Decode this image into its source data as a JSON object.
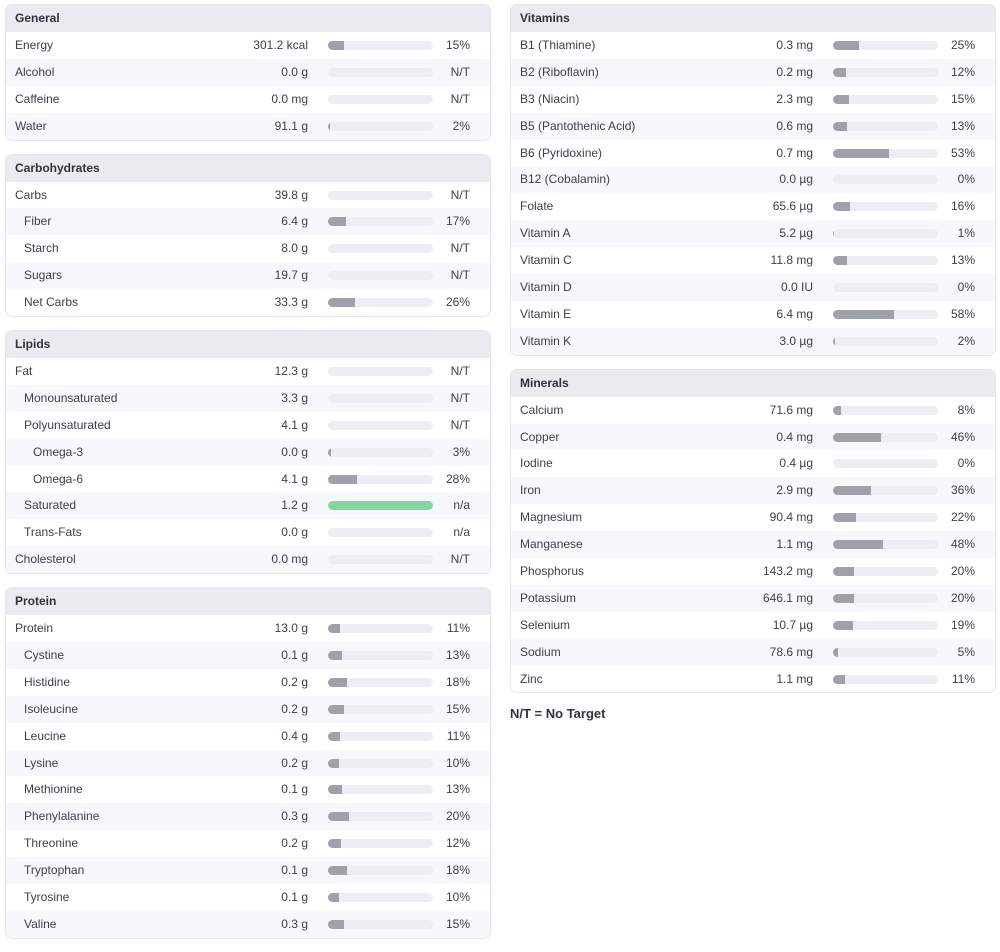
{
  "legend": "N/T = No Target",
  "left_panels": [
    {
      "title": "General",
      "rows": [
        {
          "name": "Energy",
          "amount": "301.2 kcal",
          "pct": "15%",
          "fill": 15,
          "indent": 0
        },
        {
          "name": "Alcohol",
          "amount": "0.0 g",
          "pct": "N/T",
          "fill": 0,
          "indent": 0
        },
        {
          "name": "Caffeine",
          "amount": "0.0 mg",
          "pct": "N/T",
          "fill": 0,
          "indent": 0
        },
        {
          "name": "Water",
          "amount": "91.1 g",
          "pct": "2%",
          "fill": 2,
          "indent": 0
        }
      ]
    },
    {
      "title": "Carbohydrates",
      "rows": [
        {
          "name": "Carbs",
          "amount": "39.8 g",
          "pct": "N/T",
          "fill": 0,
          "indent": 0
        },
        {
          "name": "Fiber",
          "amount": "6.4 g",
          "pct": "17%",
          "fill": 17,
          "indent": 1
        },
        {
          "name": "Starch",
          "amount": "8.0 g",
          "pct": "N/T",
          "fill": 0,
          "indent": 1
        },
        {
          "name": "Sugars",
          "amount": "19.7 g",
          "pct": "N/T",
          "fill": 0,
          "indent": 1
        },
        {
          "name": "Net Carbs",
          "amount": "33.3 g",
          "pct": "26%",
          "fill": 26,
          "indent": 1
        }
      ]
    },
    {
      "title": "Lipids",
      "rows": [
        {
          "name": "Fat",
          "amount": "12.3 g",
          "pct": "N/T",
          "fill": 0,
          "indent": 0
        },
        {
          "name": "Monounsaturated",
          "amount": "3.3 g",
          "pct": "N/T",
          "fill": 0,
          "indent": 1
        },
        {
          "name": "Polyunsaturated",
          "amount": "4.1 g",
          "pct": "N/T",
          "fill": 0,
          "indent": 1
        },
        {
          "name": "Omega-3",
          "amount": "0.0 g",
          "pct": "3%",
          "fill": 3,
          "indent": 2
        },
        {
          "name": "Omega-6",
          "amount": "4.1 g",
          "pct": "28%",
          "fill": 28,
          "indent": 2
        },
        {
          "name": "Saturated",
          "amount": "1.2 g",
          "pct": "n/a",
          "fill": 100,
          "indent": 1,
          "color": "#84d5a0"
        },
        {
          "name": "Trans-Fats",
          "amount": "0.0 g",
          "pct": "n/a",
          "fill": 0,
          "indent": 1
        },
        {
          "name": "Cholesterol",
          "amount": "0.0 mg",
          "pct": "N/T",
          "fill": 0,
          "indent": 0
        }
      ]
    },
    {
      "title": "Protein",
      "rows": [
        {
          "name": "Protein",
          "amount": "13.0 g",
          "pct": "11%",
          "fill": 11,
          "indent": 0
        },
        {
          "name": "Cystine",
          "amount": "0.1 g",
          "pct": "13%",
          "fill": 13,
          "indent": 1
        },
        {
          "name": "Histidine",
          "amount": "0.2 g",
          "pct": "18%",
          "fill": 18,
          "indent": 1
        },
        {
          "name": "Isoleucine",
          "amount": "0.2 g",
          "pct": "15%",
          "fill": 15,
          "indent": 1
        },
        {
          "name": "Leucine",
          "amount": "0.4 g",
          "pct": "11%",
          "fill": 11,
          "indent": 1
        },
        {
          "name": "Lysine",
          "amount": "0.2 g",
          "pct": "10%",
          "fill": 10,
          "indent": 1
        },
        {
          "name": "Methionine",
          "amount": "0.1 g",
          "pct": "13%",
          "fill": 13,
          "indent": 1
        },
        {
          "name": "Phenylalanine",
          "amount": "0.3 g",
          "pct": "20%",
          "fill": 20,
          "indent": 1
        },
        {
          "name": "Threonine",
          "amount": "0.2 g",
          "pct": "12%",
          "fill": 12,
          "indent": 1
        },
        {
          "name": "Tryptophan",
          "amount": "0.1 g",
          "pct": "18%",
          "fill": 18,
          "indent": 1
        },
        {
          "name": "Tyrosine",
          "amount": "0.1 g",
          "pct": "10%",
          "fill": 10,
          "indent": 1
        },
        {
          "name": "Valine",
          "amount": "0.3 g",
          "pct": "15%",
          "fill": 15,
          "indent": 1
        }
      ]
    }
  ],
  "right_panels": [
    {
      "title": "Vitamins",
      "rows": [
        {
          "name": "B1 (Thiamine)",
          "amount": "0.3 mg",
          "pct": "25%",
          "fill": 25,
          "indent": 0
        },
        {
          "name": "B2 (Riboflavin)",
          "amount": "0.2 mg",
          "pct": "12%",
          "fill": 12,
          "indent": 0
        },
        {
          "name": "B3 (Niacin)",
          "amount": "2.3 mg",
          "pct": "15%",
          "fill": 15,
          "indent": 0
        },
        {
          "name": "B5 (Pantothenic Acid)",
          "amount": "0.6 mg",
          "pct": "13%",
          "fill": 13,
          "indent": 0
        },
        {
          "name": "B6 (Pyridoxine)",
          "amount": "0.7 mg",
          "pct": "53%",
          "fill": 53,
          "indent": 0
        },
        {
          "name": "B12 (Cobalamin)",
          "amount": "0.0 µg",
          "pct": "0%",
          "fill": 0,
          "indent": 0
        },
        {
          "name": "Folate",
          "amount": "65.6 µg",
          "pct": "16%",
          "fill": 16,
          "indent": 0
        },
        {
          "name": "Vitamin A",
          "amount": "5.2 µg",
          "pct": "1%",
          "fill": 1,
          "indent": 0
        },
        {
          "name": "Vitamin C",
          "amount": "11.8 mg",
          "pct": "13%",
          "fill": 13,
          "indent": 0
        },
        {
          "name": "Vitamin D",
          "amount": "0.0 IU",
          "pct": "0%",
          "fill": 0,
          "indent": 0
        },
        {
          "name": "Vitamin E",
          "amount": "6.4 mg",
          "pct": "58%",
          "fill": 58,
          "indent": 0
        },
        {
          "name": "Vitamin K",
          "amount": "3.0 µg",
          "pct": "2%",
          "fill": 2,
          "indent": 0
        }
      ]
    },
    {
      "title": "Minerals",
      "rows": [
        {
          "name": "Calcium",
          "amount": "71.6 mg",
          "pct": "8%",
          "fill": 8,
          "indent": 0
        },
        {
          "name": "Copper",
          "amount": "0.4 mg",
          "pct": "46%",
          "fill": 46,
          "indent": 0
        },
        {
          "name": "Iodine",
          "amount": "0.4 µg",
          "pct": "0%",
          "fill": 0,
          "indent": 0
        },
        {
          "name": "Iron",
          "amount": "2.9 mg",
          "pct": "36%",
          "fill": 36,
          "indent": 0
        },
        {
          "name": "Magnesium",
          "amount": "90.4 mg",
          "pct": "22%",
          "fill": 22,
          "indent": 0
        },
        {
          "name": "Manganese",
          "amount": "1.1 mg",
          "pct": "48%",
          "fill": 48,
          "indent": 0
        },
        {
          "name": "Phosphorus",
          "amount": "143.2 mg",
          "pct": "20%",
          "fill": 20,
          "indent": 0
        },
        {
          "name": "Potassium",
          "amount": "646.1 mg",
          "pct": "20%",
          "fill": 20,
          "indent": 0
        },
        {
          "name": "Selenium",
          "amount": "10.7 µg",
          "pct": "19%",
          "fill": 19,
          "indent": 0
        },
        {
          "name": "Sodium",
          "amount": "78.6 mg",
          "pct": "5%",
          "fill": 5,
          "indent": 0
        },
        {
          "name": "Zinc",
          "amount": "1.1 mg",
          "pct": "11%",
          "fill": 11,
          "indent": 0
        }
      ]
    }
  ]
}
